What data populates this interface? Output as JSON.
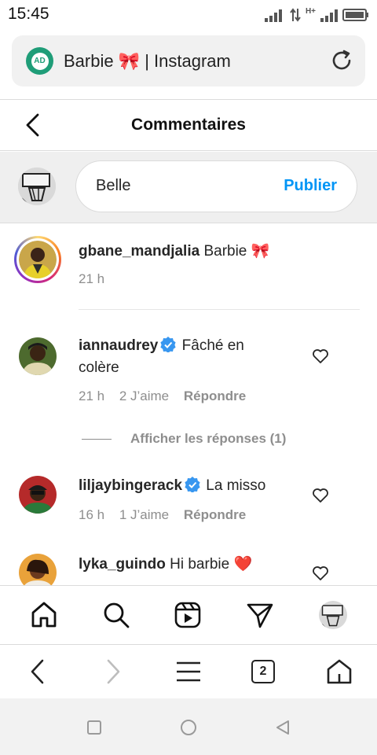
{
  "status": {
    "time": "15:45",
    "network": "H+"
  },
  "browser": {
    "tab_title": "Barbie 🎀 | Instagram",
    "site_badge": "AD",
    "tab_count": "2"
  },
  "header": {
    "title": "Commentaires"
  },
  "composer": {
    "draft_text": "Belle",
    "publish_label": "Publier"
  },
  "caption": {
    "username": "gbane_mandjalia",
    "text": " Barbie 🎀",
    "time": "21 h"
  },
  "comments": [
    {
      "username": "iannaudrey",
      "verified": true,
      "text": " Fâché en colère",
      "time": "21 h",
      "likes": "2 J’aime",
      "reply_label": "Répondre"
    },
    {
      "username": "liljaybingerack",
      "verified": true,
      "text": " La misso",
      "time": "16 h",
      "likes": "1 J’aime",
      "reply_label": "Répondre"
    },
    {
      "username": "lyka_guindo",
      "verified": false,
      "text": " Hi barbie ❤️"
    }
  ],
  "view_replies_label": "Afficher les réponses (1)",
  "colors": {
    "accent": "#0095f6",
    "muted": "#8e8e8e",
    "text": "#262626",
    "verified": "#3897f0"
  },
  "nav_icons": [
    "home-icon",
    "search-icon",
    "reels-icon",
    "direct-message-icon",
    "profile-avatar"
  ],
  "browser_icons": [
    "back-arrow-icon",
    "forward-arrow-icon",
    "menu-icon",
    "tabs-icon",
    "home-icon"
  ],
  "android_icons": [
    "recents-square-icon",
    "home-circle-icon",
    "back-triangle-icon"
  ]
}
